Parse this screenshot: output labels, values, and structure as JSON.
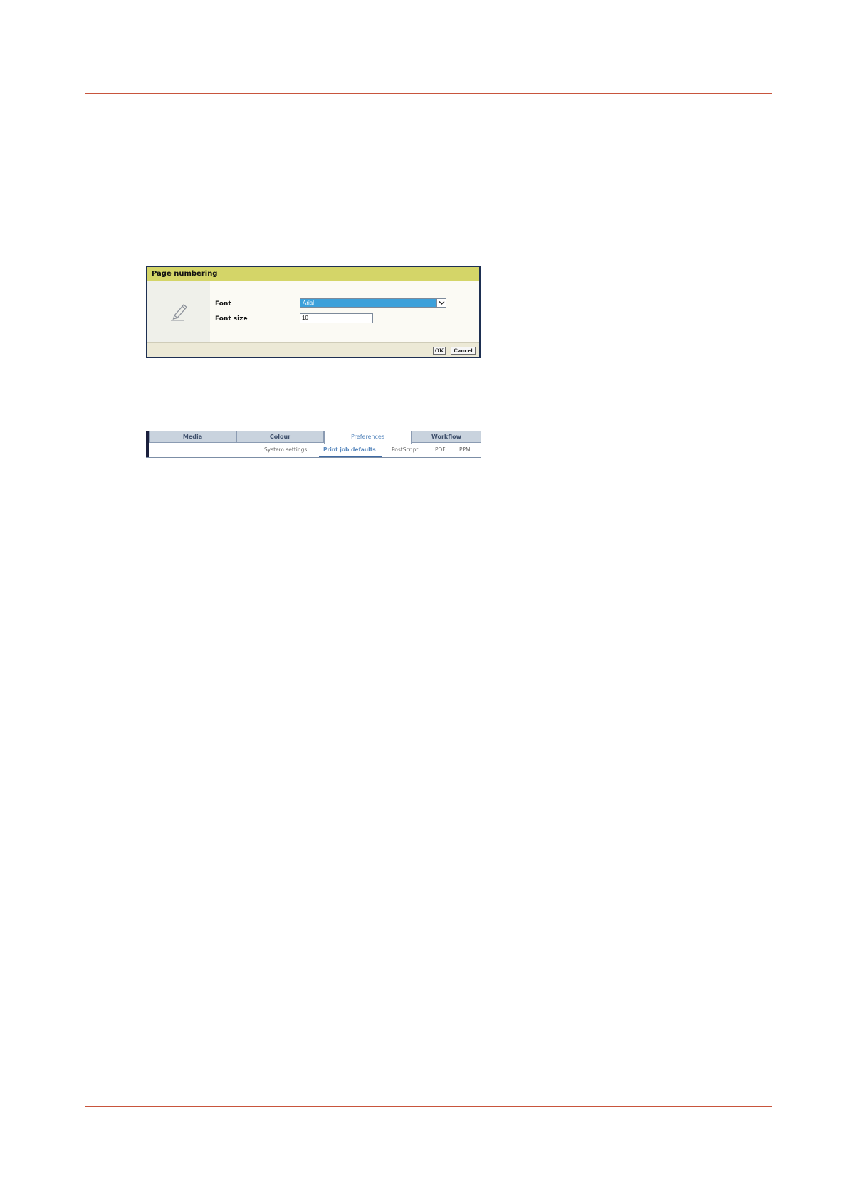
{
  "dialog": {
    "title": "Page numbering",
    "icon": "pencil-icon",
    "font_label": "Font",
    "font_value": "Arial",
    "font_size_label": "Font size",
    "font_size_value": "10",
    "ok_label": "OK",
    "cancel_label": "Cancel",
    "title_bar_color": "#d4d568",
    "selection_color": "#3ca0da"
  },
  "tabs": {
    "items": [
      {
        "label": "Media"
      },
      {
        "label": "Colour"
      },
      {
        "label": "Preferences"
      },
      {
        "label": "Workflow"
      }
    ],
    "active": "Preferences",
    "subtabs": [
      {
        "label": "System settings"
      },
      {
        "label": "Print job defaults"
      },
      {
        "label": "PostScript"
      },
      {
        "label": "PDF"
      },
      {
        "label": "PPML"
      }
    ],
    "active_subtab": "Print job defaults"
  },
  "colors": {
    "rule": "#c8553d",
    "tab_active_text": "#5a89be"
  }
}
